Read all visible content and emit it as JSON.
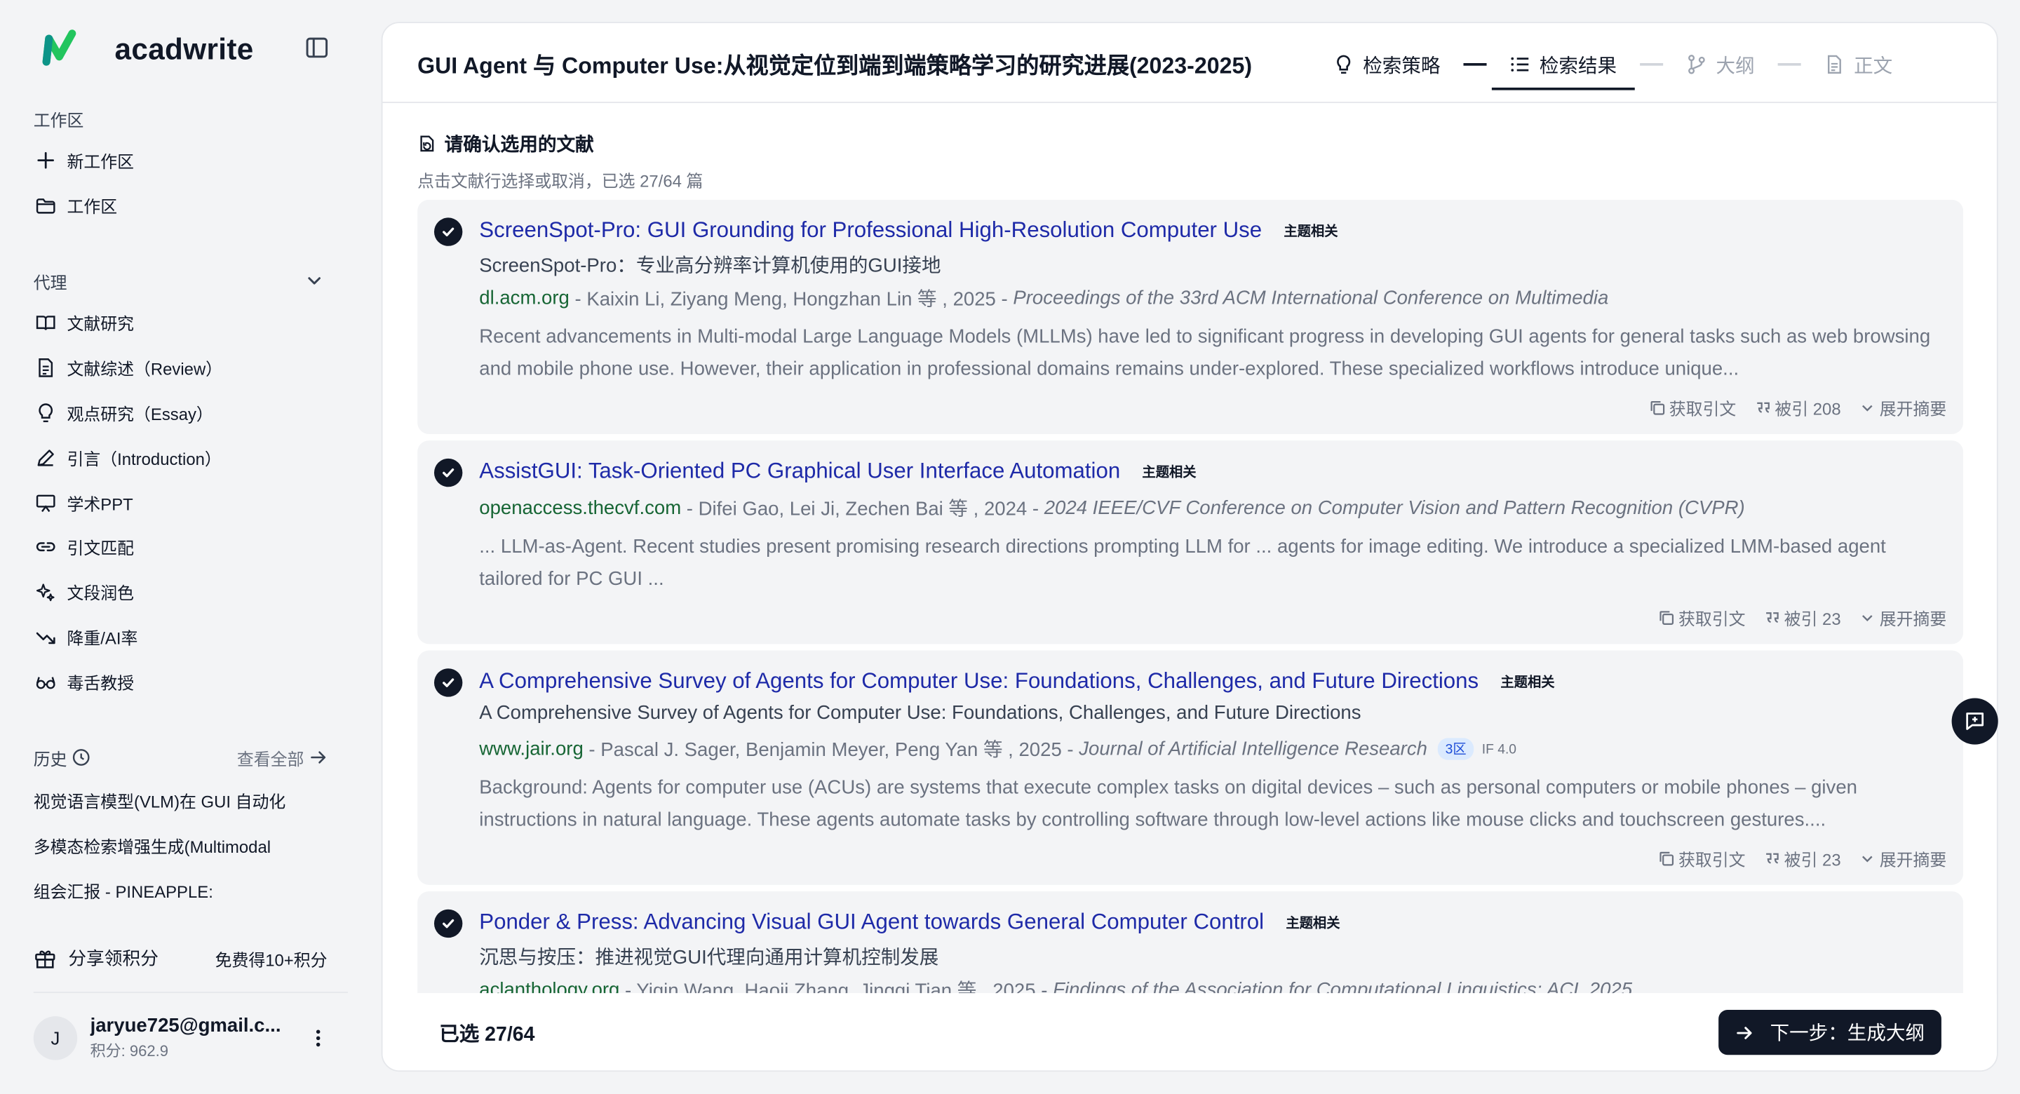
{
  "app": {
    "name": "acadwrite"
  },
  "sidebar": {
    "workspace_label": "工作区",
    "workspace_items": [
      {
        "label": "新工作区",
        "icon": "plus-icon"
      },
      {
        "label": "工作区",
        "icon": "folder-icon"
      }
    ],
    "agent_label": "代理",
    "agent_items": [
      {
        "label": "文献研究",
        "icon": "book-icon"
      },
      {
        "label": "文献综述（Review）",
        "icon": "document-icon"
      },
      {
        "label": "观点研究（Essay）",
        "icon": "lightbulb-icon"
      },
      {
        "label": "引言（Introduction）",
        "icon": "pen-icon"
      },
      {
        "label": "学术PPT",
        "icon": "presentation-icon"
      },
      {
        "label": "引文匹配",
        "icon": "link-icon"
      },
      {
        "label": "文段润色",
        "icon": "sparkle-icon"
      },
      {
        "label": "降重/AI率",
        "icon": "trend-down-icon"
      },
      {
        "label": "毒舌教授",
        "icon": "glasses-icon"
      }
    ],
    "history_label": "历史",
    "history_view_all": "查看全部",
    "history_items": [
      "视觉语言模型(VLM)在 GUI 自动化",
      "多模态检索增强生成(Multimodal",
      "组会汇报 - PINEAPPLE:"
    ],
    "share_label": "分享领积分",
    "share_reward": "免费得10+积分",
    "user": {
      "avatar_letter": "J",
      "email": "jaryue725@gmail.c...",
      "credits": "积分: 962.9"
    }
  },
  "header": {
    "title": "GUI Agent 与 Computer Use:从视觉定位到端到端策略学习的研究进展(2023-2025)",
    "steps": [
      {
        "label": "检索策略",
        "icon": "lightbulb-icon",
        "state": "done"
      },
      {
        "label": "检索结果",
        "icon": "list-icon",
        "state": "active"
      },
      {
        "label": "大纲",
        "icon": "branch-icon",
        "state": "disabled"
      },
      {
        "label": "正文",
        "icon": "document-icon",
        "state": "disabled"
      }
    ]
  },
  "selection": {
    "title": "请确认选用的文献",
    "subtitle": "点击文献行选择或取消，已选 27/64 篇",
    "footer_count": "已选 27/64",
    "next_button": "下一步：生成大纲"
  },
  "papers": [
    {
      "title": "ScreenSpot-Pro: GUI Grounding for Professional High-Resolution Computer Use",
      "tag": "主题相关",
      "translation": "ScreenSpot-Pro：专业高分辨率计算机使用的GUI接地",
      "domain": "dl.acm.org",
      "authors": " - Kaixin Li, Ziyang Meng, Hongzhan Lin 等 , 2025 - ",
      "venue": "Proceedings of the 33rd ACM International Conference on Multimedia",
      "zone": "",
      "impact": "",
      "abstract": "Recent advancements in Multi-modal Large Language Models (MLLMs) have led to significant progress in developing GUI agents for general tasks such as web browsing and mobile phone use. However, their application in professional domains remains under-explored. These specialized workflows introduce unique...",
      "cite": "获取引文",
      "cited_by": "被引 208",
      "expand": "展开摘要"
    },
    {
      "title": "AssistGUI: Task-Oriented PC Graphical User Interface Automation",
      "tag": "主题相关",
      "translation": "",
      "domain": "openaccess.thecvf.com",
      "authors": " - Difei Gao, Lei Ji, Zechen Bai 等 , 2024 - ",
      "venue": "2024 IEEE/CVF Conference on Computer Vision and Pattern Recognition (CVPR)",
      "zone": "",
      "impact": "",
      "abstract": "... LLM-as-Agent. Recent studies present promising research directions prompting LLM for ... agents for image editing. We introduce a specialized LMM-based agent tailored for PC GUI ...",
      "cite": "获取引文",
      "cited_by": "被引 23",
      "expand": "展开摘要"
    },
    {
      "title": "A Comprehensive Survey of Agents for Computer Use: Foundations, Challenges, and Future Directions",
      "tag": "主题相关",
      "translation": "A Comprehensive Survey of Agents for Computer Use: Foundations, Challenges, and Future Directions",
      "domain": "www.jair.org",
      "authors": " - Pascal J. Sager, Benjamin Meyer, Peng Yan 等 , 2025 - ",
      "venue": "Journal of Artificial Intelligence Research",
      "zone": "3区",
      "impact": "IF 4.0",
      "abstract": "Background: Agents for computer use (ACUs) are systems that execute complex tasks on digital devices – such as personal computers or mobile phones – given instructions in natural language. These agents automate tasks by controlling software through low-level actions like mouse clicks and touchscreen gestures....",
      "cite": "获取引文",
      "cited_by": "被引 23",
      "expand": "展开摘要"
    },
    {
      "title": "Ponder & Press: Advancing Visual GUI Agent towards General Computer Control",
      "tag": "主题相关",
      "translation": "沉思与按压：推进视觉GUI代理向通用计算机控制发展",
      "domain": "aclanthology.org",
      "authors": " - Yiqin Wang, Haoji Zhang, Jingqi Tian 等 , 2025 - ",
      "venue": "Findings of the Association for Computational Linguistics: ACL 2025",
      "zone": "",
      "impact": "",
      "abstract": "",
      "cite": "",
      "cited_by": "",
      "expand": ""
    }
  ]
}
